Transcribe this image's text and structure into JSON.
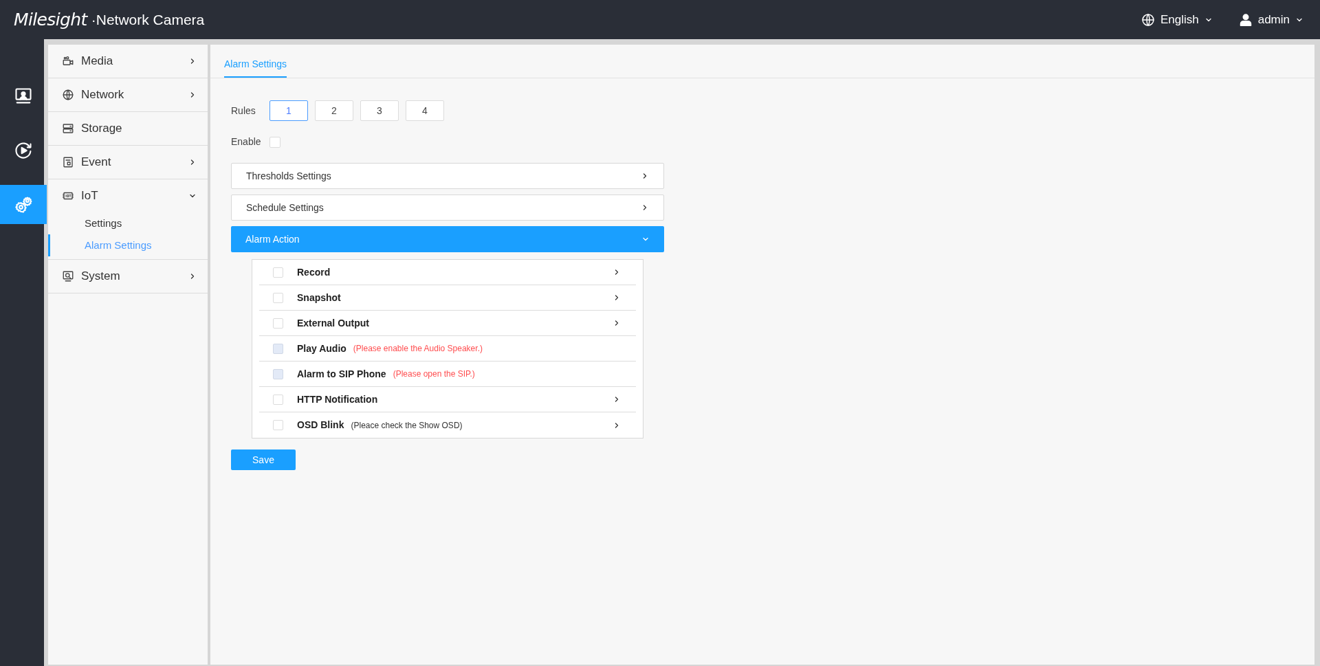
{
  "header": {
    "logo": "Milesight",
    "product": "·Network Camera",
    "language": "English",
    "user": "admin"
  },
  "rail": [
    {
      "kind": "live",
      "selected": false
    },
    {
      "kind": "playback",
      "selected": false
    },
    {
      "kind": "settings",
      "selected": true
    }
  ],
  "sidebar": {
    "items": [
      {
        "label": "Media",
        "kind": "media",
        "has_arrow": true,
        "expanded": false
      },
      {
        "label": "Network",
        "kind": "network",
        "has_arrow": true,
        "expanded": false
      },
      {
        "label": "Storage",
        "kind": "storage",
        "has_arrow": false
      },
      {
        "label": "Event",
        "kind": "event",
        "has_arrow": true,
        "expanded": false
      },
      {
        "label": "IoT",
        "kind": "iot",
        "has_arrow": true,
        "expanded": true,
        "children": [
          {
            "label": "Settings",
            "selected": false
          },
          {
            "label": "Alarm Settings",
            "selected": true
          }
        ]
      },
      {
        "label": "System",
        "kind": "system",
        "has_arrow": true,
        "expanded": false
      }
    ]
  },
  "tabs": [
    {
      "label": "Alarm Settings",
      "selected": true
    }
  ],
  "rules": {
    "label": "Rules",
    "options": [
      {
        "label": "1",
        "selected": true
      },
      {
        "label": "2",
        "selected": false
      },
      {
        "label": "3",
        "selected": false
      },
      {
        "label": "4",
        "selected": false
      }
    ]
  },
  "enable": {
    "label": "Enable",
    "checked": false
  },
  "sections": [
    {
      "label": "Thresholds Settings",
      "expanded": false
    },
    {
      "label": "Schedule Settings",
      "expanded": false
    },
    {
      "label": "Alarm Action",
      "expanded": true
    }
  ],
  "actions": [
    {
      "label": "Record",
      "checked": false,
      "disabled": false,
      "has_arrow": true
    },
    {
      "label": "Snapshot",
      "checked": false,
      "disabled": false,
      "has_arrow": true
    },
    {
      "label": "External Output",
      "checked": false,
      "disabled": false,
      "has_arrow": true
    },
    {
      "label": "Play Audio",
      "checked": false,
      "disabled": true,
      "note": "(Please enable the Audio Speaker.)",
      "has_arrow": false
    },
    {
      "label": "Alarm to SIP Phone",
      "checked": false,
      "disabled": true,
      "note": "(Please open the SIP.)",
      "has_arrow": false
    },
    {
      "label": "HTTP Notification",
      "checked": false,
      "disabled": false,
      "has_arrow": true
    },
    {
      "label": "OSD Blink",
      "checked": false,
      "disabled": false,
      "note": "(Pleace check the Show OSD)",
      "has_arrow": true
    }
  ],
  "save_button": "Save"
}
